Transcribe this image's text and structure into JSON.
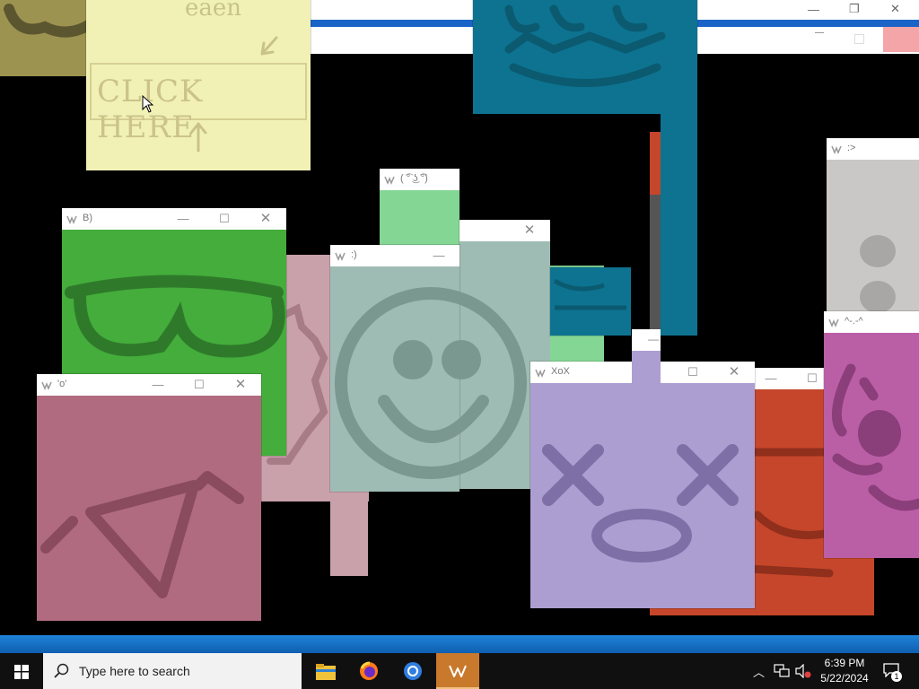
{
  "top_window": {
    "minimize_label": "—",
    "maximize_label": "❐",
    "close_label": "✕"
  },
  "sticky_note": {
    "text_top": "eaen",
    "click_here": "CLICK HERE"
  },
  "windows": {
    "b_sunglasses": {
      "title": "B)",
      "color": "#44ad3c"
    },
    "hearts": {
      "title": "'o'",
      "color": "#b06b80"
    },
    "smiley": {
      "title": ":)",
      "color": "#9fbcb4"
    },
    "lenny": {
      "title": "( ͡° ͜ʖ ͡°)",
      "color": "#84d694"
    },
    "xox": {
      "title": "XoX",
      "color": "#ad9ed1"
    },
    "colon_gt": {
      "title": ":>",
      "color": "#c9c8c6"
    },
    "caret": {
      "title": "^-.-^",
      "color": "#ba5ea6"
    }
  },
  "taskbar": {
    "search_placeholder": "Type here to search",
    "time": "6:39 PM",
    "date": "5/22/2024",
    "notification_count": "1"
  },
  "colors": {
    "taskbar_accent": "#1a73c8",
    "teal": "#0d7390",
    "orange": "#c5462a",
    "olive": "#9d9350",
    "pink_bg": "#c9a1aa",
    "sticky": "#f1f1b6"
  }
}
